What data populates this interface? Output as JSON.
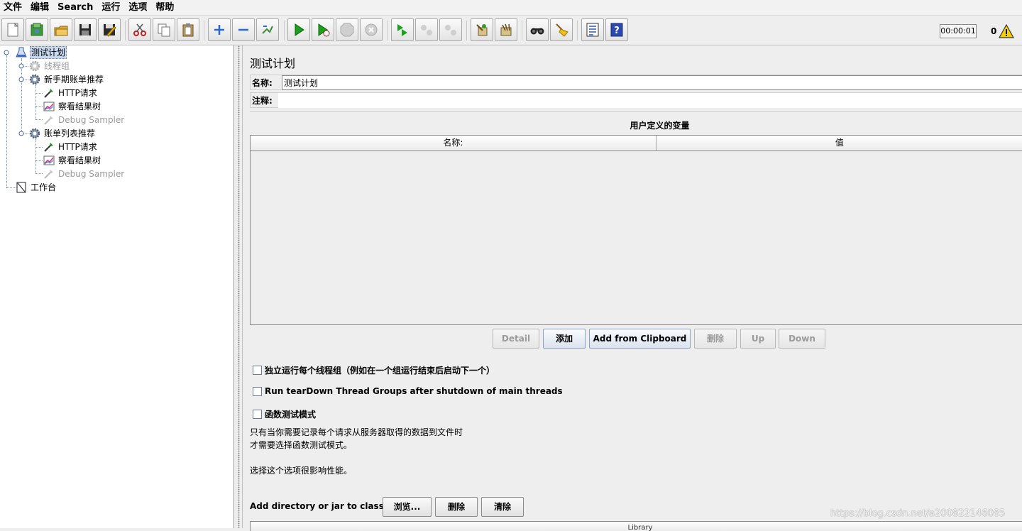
{
  "menubar": {
    "items": [
      "文件",
      "编辑",
      "Search",
      "运行",
      "选项",
      "帮助"
    ]
  },
  "toolbar": {
    "buttons": [
      {
        "icon": "new-icon"
      },
      {
        "icon": "templates-icon"
      },
      {
        "icon": "open-icon"
      },
      {
        "icon": "save-icon"
      },
      {
        "icon": "save-as-icon"
      },
      {
        "icon": "cut-icon"
      },
      {
        "icon": "copy-icon"
      },
      {
        "icon": "paste-icon"
      },
      {
        "icon": "expand-icon"
      },
      {
        "icon": "collapse-icon"
      },
      {
        "icon": "toggle-icon"
      },
      {
        "icon": "start-icon"
      },
      {
        "icon": "start-no-timers-icon"
      },
      {
        "icon": "stop-icon"
      },
      {
        "icon": "shutdown-icon"
      },
      {
        "icon": "remote-start-icon"
      },
      {
        "icon": "remote-stop-icon"
      },
      {
        "icon": "remote-shutdown-icon"
      },
      {
        "icon": "clear-icon"
      },
      {
        "icon": "clear-all-icon"
      },
      {
        "icon": "search-icon"
      },
      {
        "icon": "reset-search-icon"
      },
      {
        "icon": "function-helper-icon"
      },
      {
        "icon": "help-icon"
      }
    ],
    "timer": "00:00:01",
    "error_count": "0"
  },
  "tree": {
    "nodes": [
      {
        "label": "测试计划",
        "icon": "test-plan-icon",
        "selected": true,
        "disabled": false
      },
      {
        "label": "线程组",
        "icon": "thread-group-icon",
        "selected": false,
        "disabled": true
      },
      {
        "label": "新手期账单推荐",
        "icon": "thread-group-icon",
        "selected": false,
        "disabled": false
      },
      {
        "label": "HTTP请求",
        "icon": "http-sampler-icon",
        "selected": false,
        "disabled": false
      },
      {
        "label": "察看结果树",
        "icon": "results-tree-icon",
        "selected": false,
        "disabled": false
      },
      {
        "label": "Debug Sampler",
        "icon": "debug-sampler-icon",
        "selected": false,
        "disabled": true
      },
      {
        "label": "账单列表推荐",
        "icon": "thread-group-icon",
        "selected": false,
        "disabled": false
      },
      {
        "label": "HTTP请求",
        "icon": "http-sampler-icon",
        "selected": false,
        "disabled": false
      },
      {
        "label": "察看结果树",
        "icon": "results-tree-icon",
        "selected": false,
        "disabled": false
      },
      {
        "label": "Debug Sampler",
        "icon": "debug-sampler-icon",
        "selected": false,
        "disabled": true
      },
      {
        "label": "工作台",
        "icon": "workbench-icon",
        "selected": false,
        "disabled": false
      }
    ]
  },
  "main": {
    "title": "测试计划",
    "name_label": "名称:",
    "name_value": "测试计划",
    "comment_label": "注释:",
    "comment_value": "",
    "variables_title": "用户定义的变量",
    "table": {
      "columns": [
        "名称:",
        "值"
      ],
      "rows": []
    },
    "buttons": {
      "detail": "Detail",
      "add": "添加",
      "add_clipboard": "Add from Clipboard",
      "delete": "删除",
      "up": "Up",
      "down": "Down"
    },
    "options": {
      "serialize": "独立运行每个线程组（例如在一个组运行结束后启动下一个）",
      "teardown": "Run tearDown Thread Groups after shutdown of main threads",
      "functional": "函数测试模式"
    },
    "help": {
      "line1": "只有当你需要记录每个请求从服务器取得的数据到文件时",
      "line2": "才需要选择函数测试模式。",
      "line3": "选择这个选项很影响性能。"
    },
    "classpath": {
      "label": "Add directory or jar to classpath",
      "browse": "浏览...",
      "delete": "删除",
      "clear": "清除",
      "library_header": "Library"
    }
  },
  "watermark": "https://blog.csdn.net/a200822146085"
}
